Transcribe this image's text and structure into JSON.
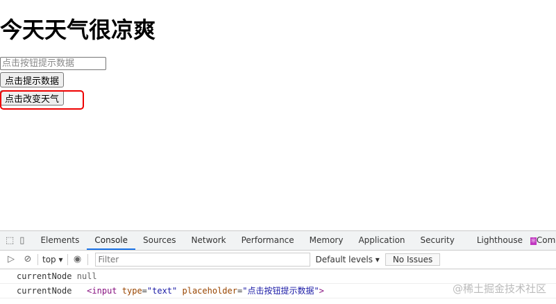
{
  "page": {
    "heading": "今天天气很凉爽",
    "input_placeholder": "点击按钮提示数据",
    "button1": "点击提示数据",
    "button2": "点击改变天气"
  },
  "devtools": {
    "tabs": [
      "Elements",
      "Console",
      "Sources",
      "Network",
      "Performance",
      "Memory",
      "Application",
      "Security",
      "Lighthouse",
      "Com"
    ],
    "context": "top ▾",
    "filter_placeholder": "Filter",
    "levels": "Default levels ▾",
    "issues": "No Issues",
    "logs": [
      {
        "label": "currentNode",
        "value": "null"
      },
      {
        "label": "currentNode",
        "tag": "<input",
        "a1": "type",
        "v1": "\"text\"",
        "a2": "placeholder",
        "v2": "\"点击按钮提示数据\"",
        "end": ">"
      }
    ]
  },
  "watermark": "@稀土掘金技术社区"
}
